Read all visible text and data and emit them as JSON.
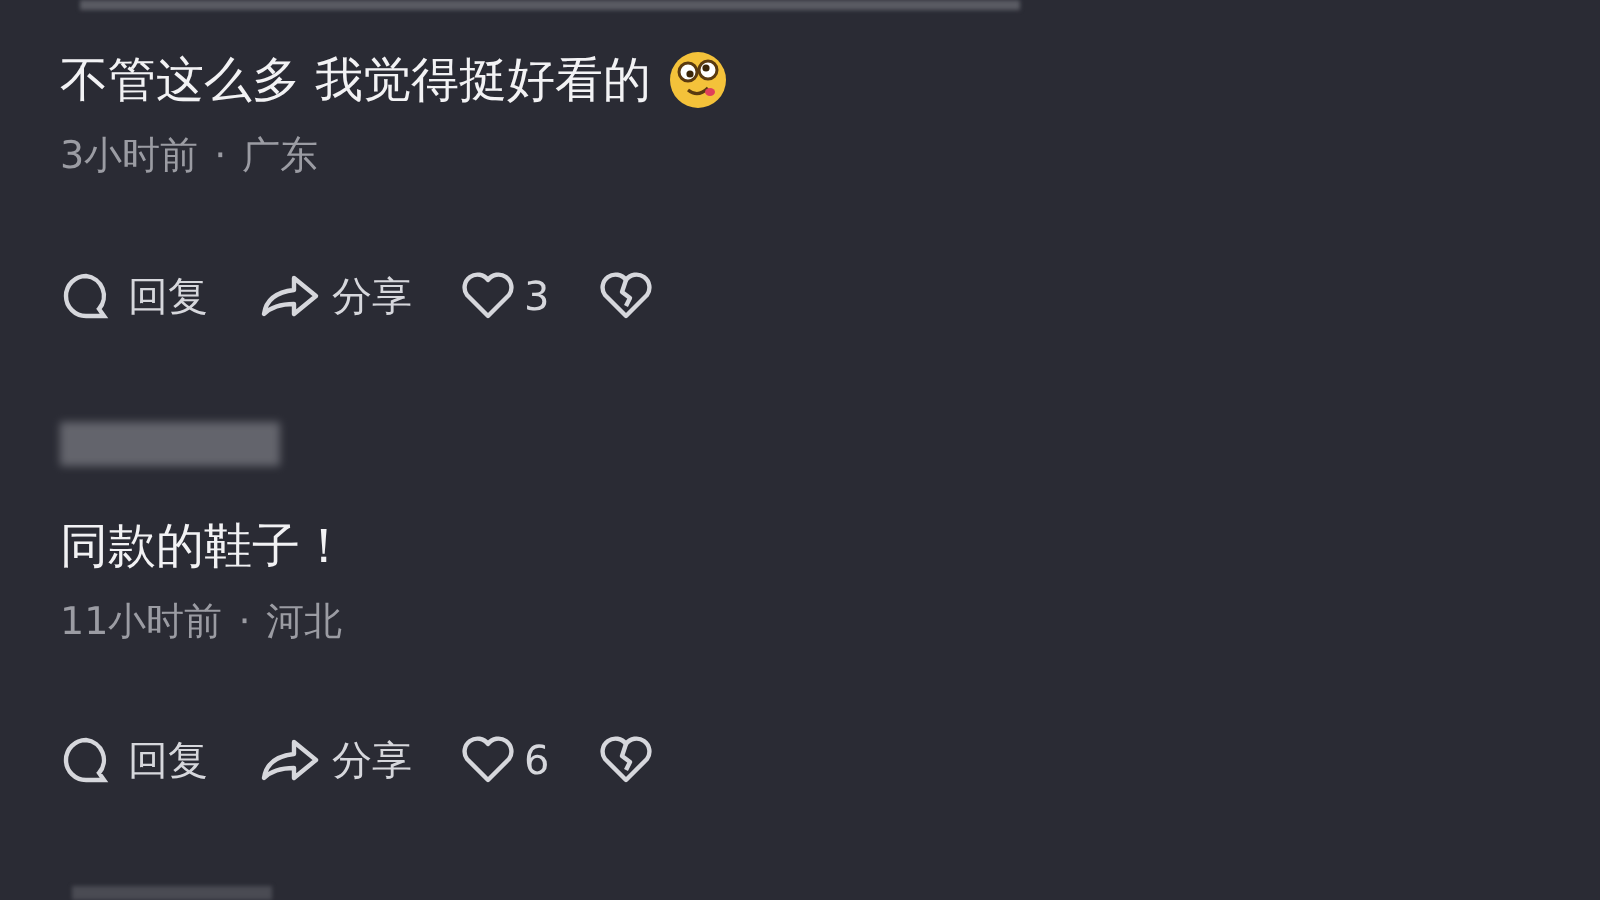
{
  "comments": [
    {
      "text": "不管这么多 我觉得挺好看的",
      "has_emoji": true,
      "name_hidden": false,
      "time": "3小时前",
      "separator": "·",
      "location": "广东",
      "reply": "回复",
      "share": "分享",
      "likes": "3"
    },
    {
      "text": "同款的鞋子！",
      "has_emoji": false,
      "name_hidden": true,
      "time": "11小时前",
      "separator": "·",
      "location": "河北",
      "reply": "回复",
      "share": "分享",
      "likes": "6"
    }
  ]
}
